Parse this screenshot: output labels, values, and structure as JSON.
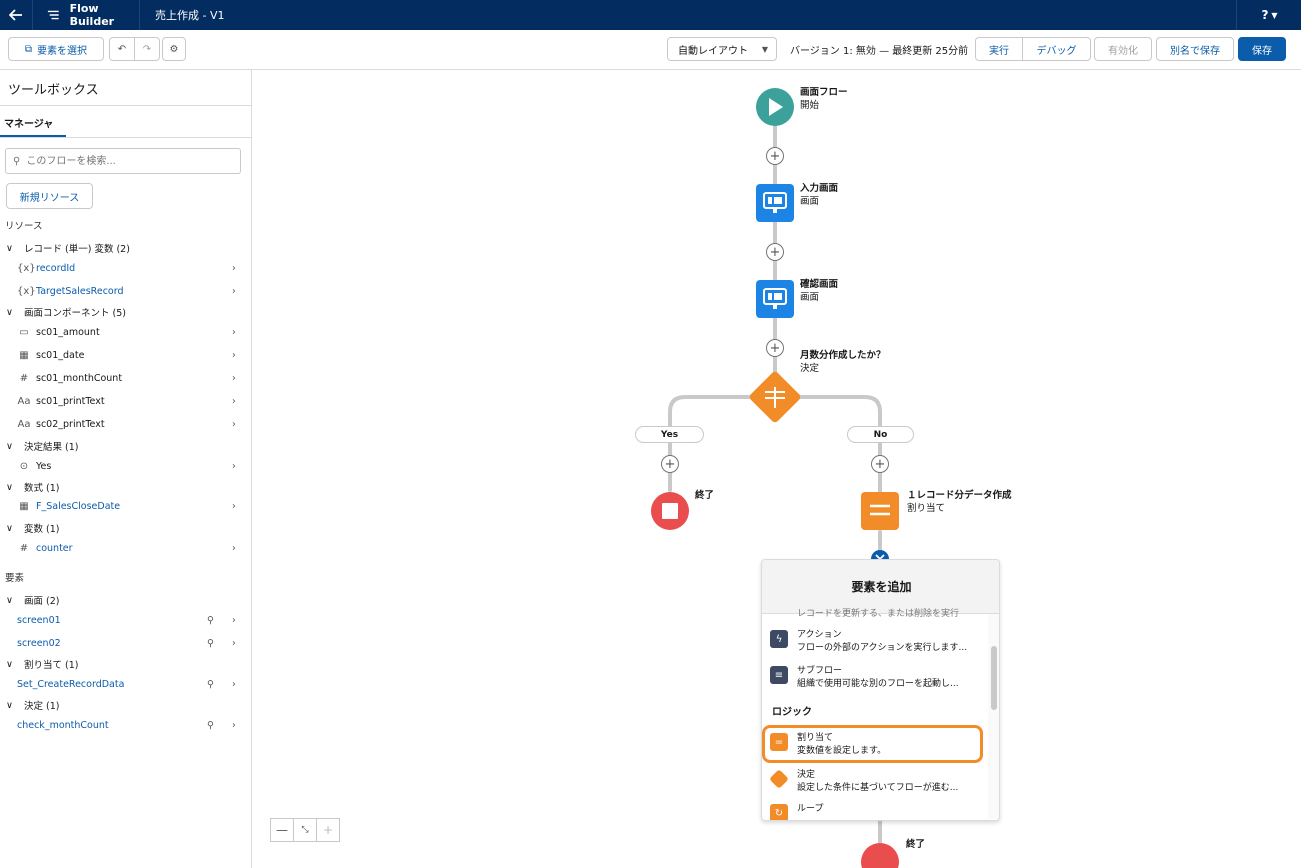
{
  "header": {
    "app_name": "Flow Builder",
    "flow_title": "売上作成 - V1",
    "help_label": "?"
  },
  "toolbar": {
    "select_elements": "要素を選択",
    "layout": "自動レイアウト",
    "version_info": "バージョン 1: 無効 — 最終更新 25分前",
    "run": "実行",
    "debug": "デバッグ",
    "activate": "有効化",
    "save_as": "別名で保存",
    "save": "保存"
  },
  "sidebar": {
    "title": "ツールボックス",
    "tab": "マネージャ",
    "search_placeholder": "このフローを検索...",
    "new_resource": "新規リソース",
    "resources_label": "リソース",
    "groups": [
      {
        "label": "レコード (単一) 変数 (2)",
        "items": [
          {
            "icon": "{x}",
            "label": "recordId"
          },
          {
            "icon": "{x}",
            "label": "TargetSalesRecord"
          }
        ]
      },
      {
        "label": "画面コンポーネント (5)",
        "items": [
          {
            "icon": "▭",
            "label": "sc01_amount"
          },
          {
            "icon": "▦",
            "label": "sc01_date"
          },
          {
            "icon": "#",
            "label": "sc01_monthCount"
          },
          {
            "icon": "Aa",
            "label": "sc01_printText"
          },
          {
            "icon": "Aa",
            "label": "sc02_printText"
          }
        ]
      },
      {
        "label": "決定結果 (1)",
        "items": [
          {
            "icon": "⊙",
            "label": "Yes"
          }
        ]
      },
      {
        "label": "数式 (1)",
        "items": [
          {
            "icon": "▦",
            "label": "F_SalesCloseDate"
          }
        ]
      },
      {
        "label": "変数 (1)",
        "items": [
          {
            "icon": "#",
            "label": "counter"
          }
        ]
      }
    ],
    "elements_label": "要素",
    "element_groups": [
      {
        "label": "画面 (2)",
        "items": [
          "screen01",
          "screen02"
        ]
      },
      {
        "label": "割り当て (1)",
        "items": [
          "Set_CreateRecordData"
        ]
      },
      {
        "label": "決定 (1)",
        "items": [
          "check_monthCount"
        ]
      }
    ]
  },
  "canvas": {
    "start": {
      "title": "画面フロー",
      "sub": "開始"
    },
    "input_screen": {
      "title": "入力画面",
      "sub": "画面"
    },
    "confirm_screen": {
      "title": "確認画面",
      "sub": "画面"
    },
    "decision": {
      "title": "月数分作成したか？",
      "sub": "決定"
    },
    "yes_label": "Yes",
    "no_label": "No",
    "end_yes": "終了",
    "assignment": {
      "title": "１レコード分データ作成",
      "sub": "割り当て"
    },
    "end_bottom": "終了"
  },
  "popover": {
    "title": "要素を追加",
    "top_cut": "レコードを更新する、または削除を実行",
    "action": {
      "title": "アクション",
      "desc": "フローの外部のアクションを実行します..."
    },
    "subflow": {
      "title": "サブフロー",
      "desc": "組織で使用可能な別のフローを起動し..."
    },
    "logic_section": "ロジック",
    "assign": {
      "title": "割り当て",
      "desc": "変数値を設定します。"
    },
    "decide": {
      "title": "決定",
      "desc": "設定した条件に基づいてフローが進む..."
    },
    "loop": {
      "title": "ループ"
    }
  },
  "colors": {
    "header_bg": "#032d60",
    "brand": "#0b5cab",
    "start": "#3ba19a",
    "screen": "#1b84e5",
    "decision": "#f28c28",
    "end": "#ea4d4d",
    "highlight": "#f28c28"
  }
}
